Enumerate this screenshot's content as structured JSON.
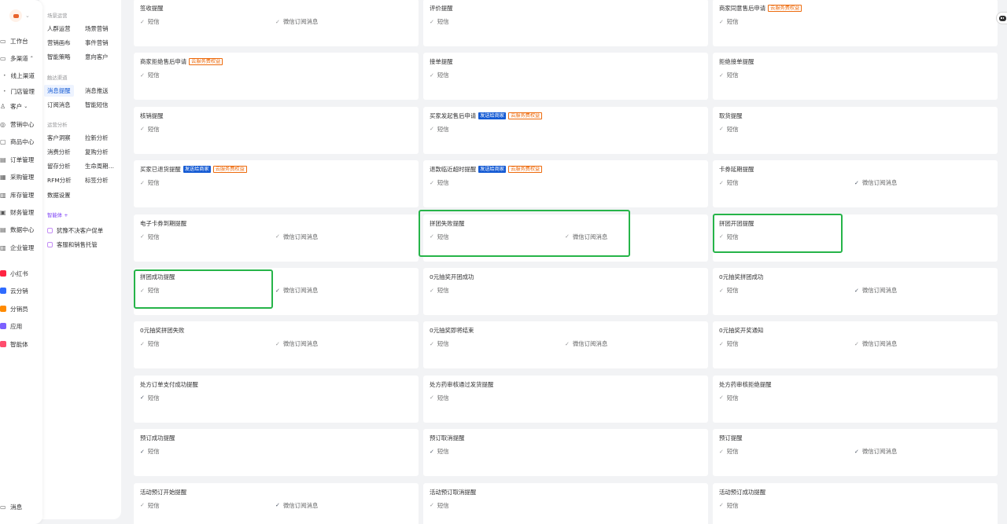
{
  "leftnav": {
    "items": [
      {
        "label": "工作台",
        "icon": "workbench-icon"
      },
      {
        "label": "多渠道",
        "icon": "channel-icon",
        "expanded": true
      },
      {
        "label": "线上渠道",
        "sub": true
      },
      {
        "label": "门店管理",
        "sub": true
      },
      {
        "label": "客户",
        "icon": "customer-icon"
      },
      {
        "label": "营销中心",
        "icon": "marketing-icon"
      },
      {
        "label": "商品中心",
        "icon": "goods-icon"
      },
      {
        "label": "订单管理",
        "icon": "order-icon"
      },
      {
        "label": "采购管理",
        "icon": "purchase-icon"
      },
      {
        "label": "库存管理",
        "icon": "stock-icon"
      },
      {
        "label": "财务管理",
        "icon": "finance-icon"
      },
      {
        "label": "数据中心",
        "icon": "data-icon"
      },
      {
        "label": "企业管理",
        "icon": "enterprise-icon"
      }
    ],
    "apps": [
      {
        "label": "小红书",
        "color": "#ff2442"
      },
      {
        "label": "云分销",
        "color": "#2f6bff"
      },
      {
        "label": "分销员",
        "color": "#ff8a00"
      },
      {
        "label": "应用",
        "color": "#7b61ff"
      },
      {
        "label": "智能体",
        "color": "#ff4d6d"
      }
    ],
    "message_label": "消息"
  },
  "subnav": {
    "groups": [
      {
        "title": "场景运营",
        "items": [
          "人群运营",
          "场景营销",
          "营销画布",
          "事件营销",
          "智能策略",
          "意向客户"
        ]
      },
      {
        "title": "触达渠道",
        "items": [
          "消息提醒",
          "消息推送",
          "订阅消息",
          "智能短信"
        ]
      },
      {
        "title": "运营分析",
        "items": [
          "客户洞察",
          "拉新分析",
          "消费分析",
          "复购分析",
          "留存分析",
          "生命周期…",
          "RFM分析",
          "标签分析",
          "数据设置"
        ]
      }
    ],
    "ai": {
      "title": "智能体 +",
      "items": [
        "犹豫不决客户促单",
        "客服和销售托管"
      ]
    }
  },
  "cards": [
    {
      "title": "签收提醒",
      "tags": [],
      "opts": [
        {
          "label": "短信",
          "on": false
        },
        {
          "label": "微信订阅消息",
          "on": false
        }
      ]
    },
    {
      "title": "评价提醒",
      "tags": [],
      "opts": [
        {
          "label": "短信",
          "on": false
        }
      ]
    },
    {
      "title": "商家同意售后申请",
      "tags": [
        {
          "label": "云服务费权益",
          "type": "orange"
        }
      ],
      "opts": [
        {
          "label": "短信",
          "on": false
        }
      ]
    },
    {
      "title": "商家拒绝售后申请",
      "tags": [
        {
          "label": "云服务费权益",
          "type": "orange"
        }
      ],
      "opts": [
        {
          "label": "短信",
          "on": false
        }
      ]
    },
    {
      "title": "接单提醒",
      "tags": [],
      "opts": [
        {
          "label": "短信",
          "on": false
        }
      ]
    },
    {
      "title": "拒绝接单提醒",
      "tags": [],
      "opts": [
        {
          "label": "短信",
          "on": false
        }
      ]
    },
    {
      "title": "核销提醒",
      "tags": [],
      "opts": [
        {
          "label": "短信",
          "on": false
        }
      ]
    },
    {
      "title": "买家发起售后申请",
      "tags": [
        {
          "label": "发送给商家",
          "type": "blue"
        },
        {
          "label": "云服务费权益",
          "type": "orange"
        }
      ],
      "opts": [
        {
          "label": "短信",
          "on": false
        }
      ]
    },
    {
      "title": "取货提醒",
      "tags": [],
      "opts": [
        {
          "label": "短信",
          "on": false
        }
      ]
    },
    {
      "title": "买家已退货提醒",
      "tags": [
        {
          "label": "发送给商家",
          "type": "blue"
        },
        {
          "label": "云服务费权益",
          "type": "orange"
        }
      ],
      "opts": [
        {
          "label": "短信",
          "on": false
        }
      ]
    },
    {
      "title": "退款临近超时提醒",
      "tags": [
        {
          "label": "发送给商家",
          "type": "blue"
        },
        {
          "label": "云服务费权益",
          "type": "orange"
        }
      ],
      "opts": [
        {
          "label": "短信",
          "on": false
        }
      ]
    },
    {
      "title": "卡券延期提醒",
      "tags": [],
      "opts": [
        {
          "label": "短信",
          "on": false
        },
        {
          "label": "微信订阅消息",
          "on": true
        }
      ]
    },
    {
      "title": "电子卡券到期提醒",
      "tags": [],
      "opts": [
        {
          "label": "短信",
          "on": false
        },
        {
          "label": "微信订阅消息",
          "on": false
        }
      ]
    },
    {
      "title": "拼团失败提醒",
      "tags": [],
      "opts": [
        {
          "label": "短信",
          "on": false
        },
        {
          "label": "微信订阅消息",
          "on": false
        }
      ]
    },
    {
      "title": "拼团开团提醒",
      "tags": [],
      "opts": [
        {
          "label": "短信",
          "on": false
        }
      ]
    },
    {
      "title": "拼团成功提醒",
      "tags": [],
      "opts": [
        {
          "label": "短信",
          "on": false
        },
        {
          "label": "微信订阅消息",
          "on": true
        }
      ]
    },
    {
      "title": "0元抽奖开团成功",
      "tags": [],
      "opts": [
        {
          "label": "短信",
          "on": false
        }
      ]
    },
    {
      "title": "0元抽奖拼团成功",
      "tags": [],
      "opts": [
        {
          "label": "短信",
          "on": false
        },
        {
          "label": "微信订阅消息",
          "on": true
        }
      ]
    },
    {
      "title": "0元抽奖拼团失败",
      "tags": [],
      "opts": [
        {
          "label": "短信",
          "on": false
        },
        {
          "label": "微信订阅消息",
          "on": false
        }
      ]
    },
    {
      "title": "0元抽奖即将结束",
      "tags": [],
      "opts": [
        {
          "label": "短信",
          "on": false
        },
        {
          "label": "微信订阅消息",
          "on": false
        }
      ]
    },
    {
      "title": "0元抽奖开奖通知",
      "tags": [],
      "opts": [
        {
          "label": "短信",
          "on": false
        },
        {
          "label": "微信订阅消息",
          "on": false
        }
      ]
    },
    {
      "title": "处方订单支付成功提醒",
      "tags": [],
      "opts": [
        {
          "label": "短信",
          "on": true
        }
      ]
    },
    {
      "title": "处方药审核通过发货提醒",
      "tags": [],
      "opts": [
        {
          "label": "短信",
          "on": false
        }
      ]
    },
    {
      "title": "处方药审核拒绝提醒",
      "tags": [],
      "opts": [
        {
          "label": "短信",
          "on": false
        }
      ]
    },
    {
      "title": "预订成功提醒",
      "tags": [],
      "opts": [
        {
          "label": "短信",
          "on": true
        }
      ]
    },
    {
      "title": "预订取消提醒",
      "tags": [],
      "opts": [
        {
          "label": "短信",
          "on": true
        }
      ]
    },
    {
      "title": "预订提醒",
      "tags": [],
      "opts": [
        {
          "label": "短信",
          "on": false
        },
        {
          "label": "微信订阅消息",
          "on": true
        }
      ]
    },
    {
      "title": "活动预订开始提醒",
      "tags": [],
      "opts": [
        {
          "label": "短信",
          "on": false
        },
        {
          "label": "微信订阅消息",
          "on": true
        }
      ]
    },
    {
      "title": "活动预订取消提醒",
      "tags": [],
      "opts": [
        {
          "label": "短信",
          "on": false
        }
      ]
    },
    {
      "title": "活动预订成功提醒",
      "tags": [],
      "opts": [
        {
          "label": "短信",
          "on": false
        }
      ]
    }
  ],
  "colors": {
    "accent": "#155bd4",
    "highlight": "#26b449",
    "warning": "#ed6a0c"
  }
}
